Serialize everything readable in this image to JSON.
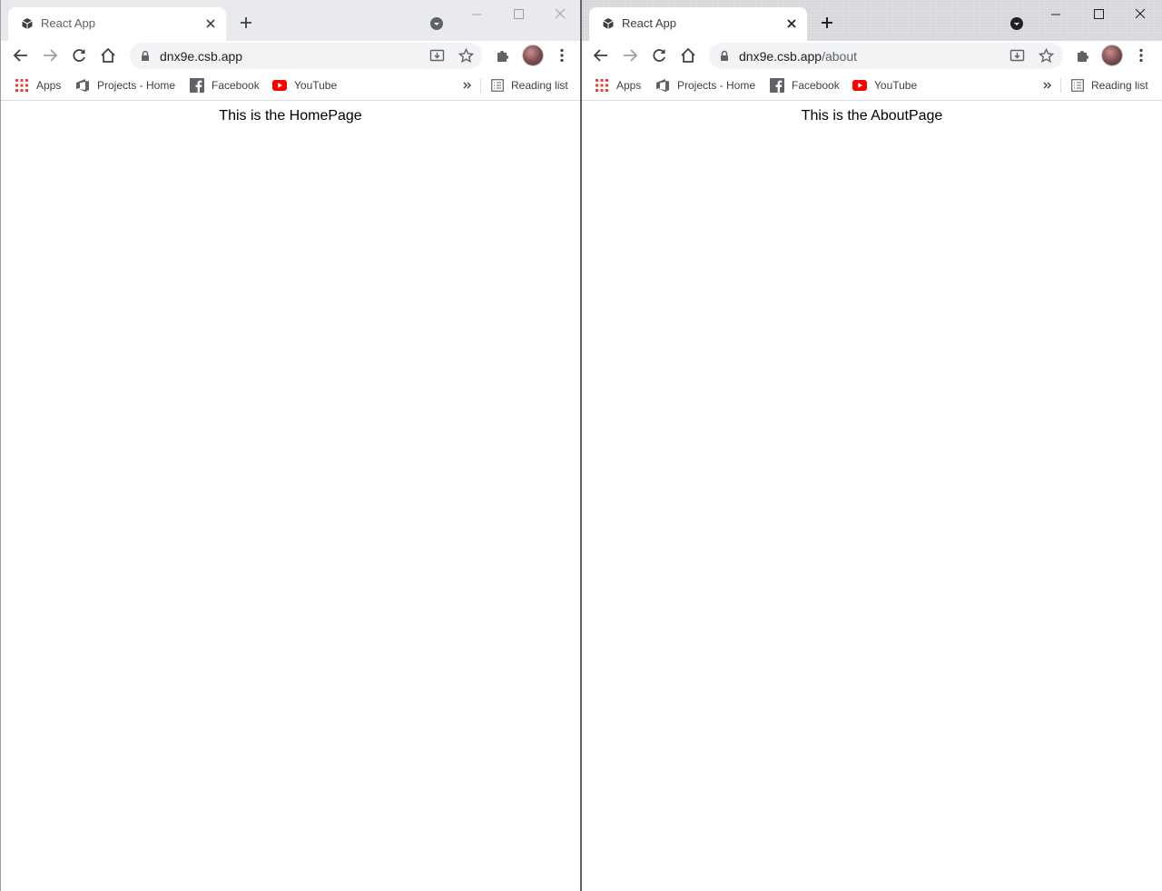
{
  "windows": [
    {
      "tab": {
        "title": "React App"
      },
      "omnibox": {
        "host": "dnx9e.csb.app",
        "path": ""
      },
      "bookmarks": [
        {
          "label": "Apps",
          "icon": "apps-grid-icon"
        },
        {
          "label": "Projects - Home",
          "icon": "azure-devops-icon"
        },
        {
          "label": "Facebook",
          "icon": "facebook-icon"
        },
        {
          "label": "YouTube",
          "icon": "youtube-icon"
        }
      ],
      "reading_list": "Reading list",
      "content": {
        "text": "This is the HomePage"
      }
    },
    {
      "tab": {
        "title": "React App"
      },
      "omnibox": {
        "host": "dnx9e.csb.app",
        "path": "/about"
      },
      "bookmarks": [
        {
          "label": "Apps",
          "icon": "apps-grid-icon"
        },
        {
          "label": "Projects - Home",
          "icon": "azure-devops-icon"
        },
        {
          "label": "Facebook",
          "icon": "facebook-icon"
        },
        {
          "label": "YouTube",
          "icon": "youtube-icon"
        }
      ],
      "reading_list": "Reading list",
      "content": {
        "text": "This is the AboutPage"
      }
    }
  ],
  "colors": {
    "youtube_red": "#ff0000",
    "facebook_blue": "#3b5998",
    "apps_grid": "#ea4335",
    "devops_blue": "#0078d4"
  }
}
